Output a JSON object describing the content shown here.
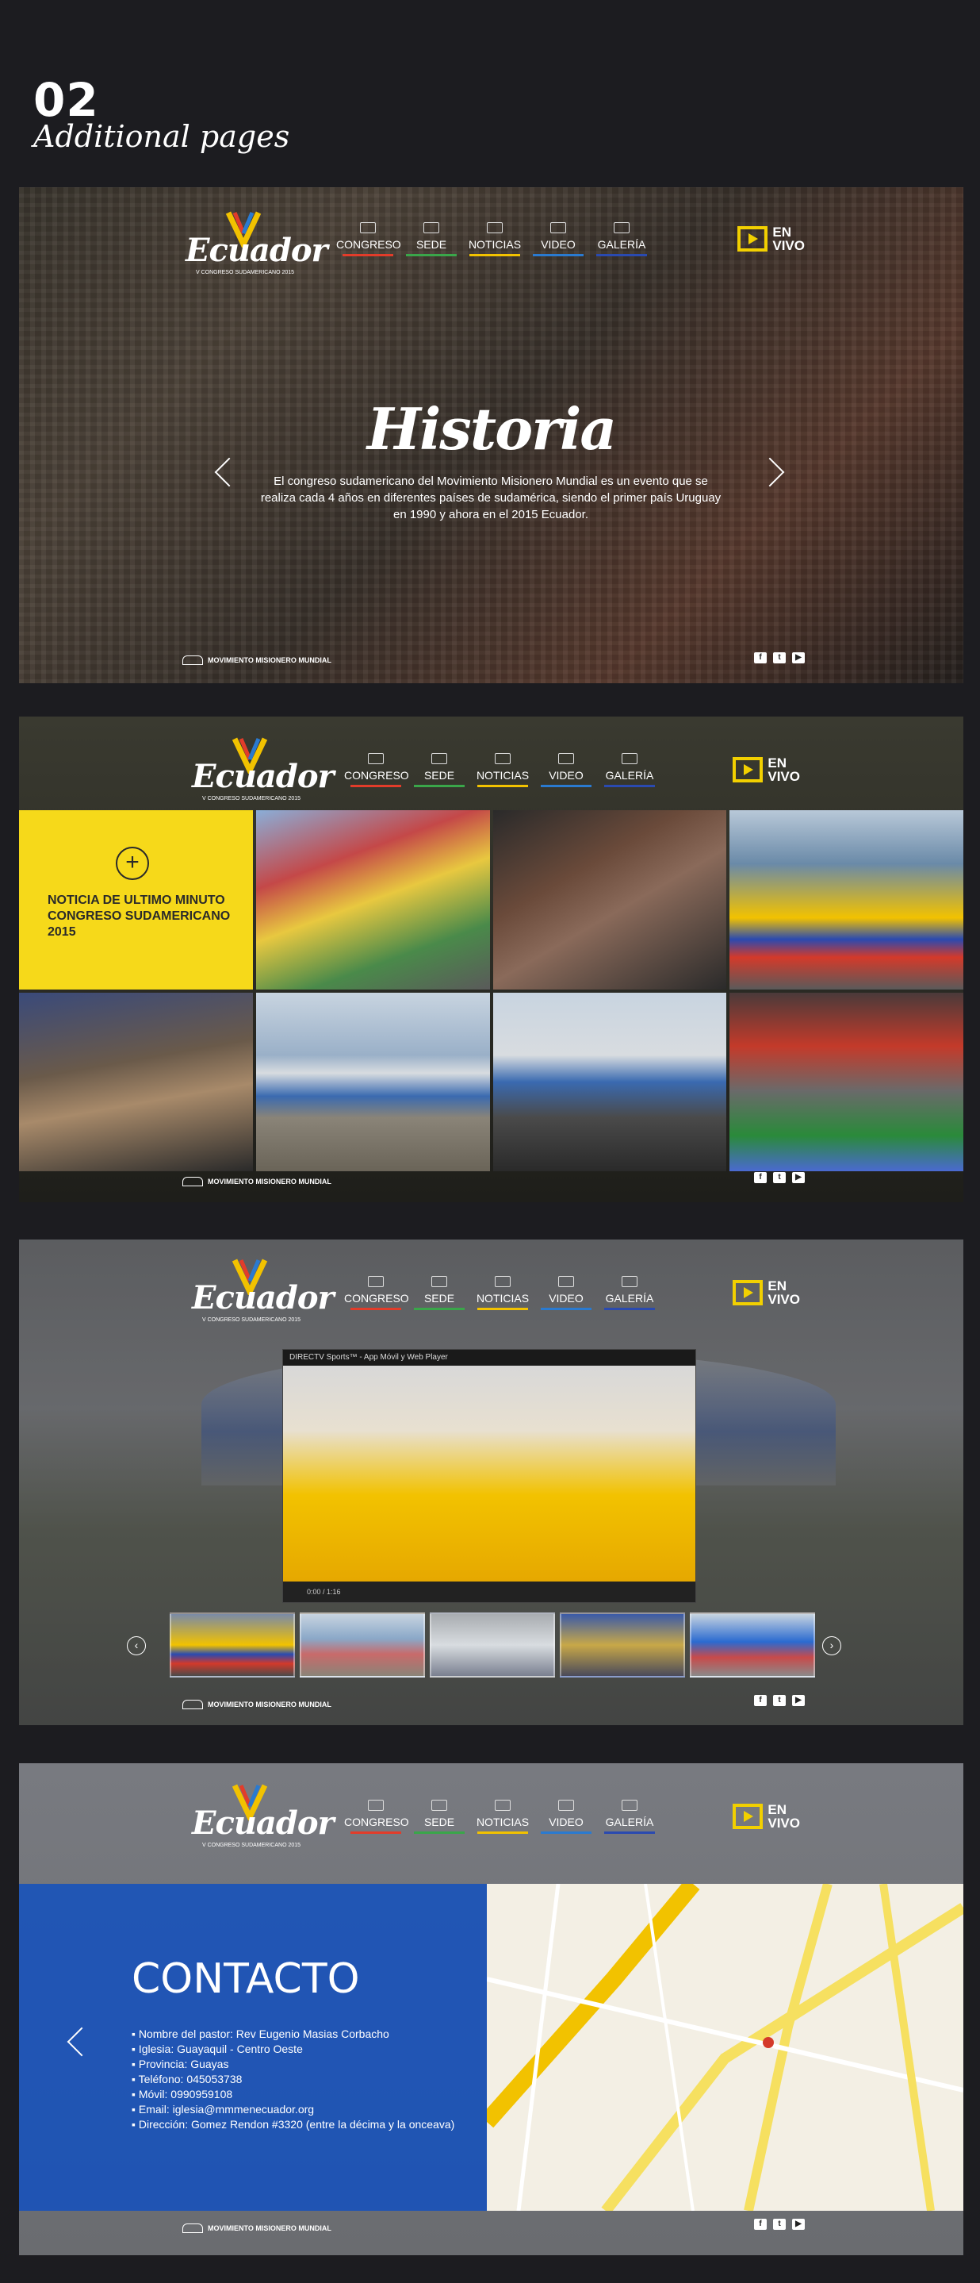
{
  "header": {
    "number": "02",
    "subtitle": "Additional pages"
  },
  "nav": {
    "items": [
      {
        "label": "CONGRESO",
        "color": "#e23c2a"
      },
      {
        "label": "SEDE",
        "color": "#3aa64a"
      },
      {
        "label": "NOTICIAS",
        "color": "#f2c200"
      },
      {
        "label": "VIDEO",
        "color": "#2a7ad0"
      },
      {
        "label": "GALERÍA",
        "color": "#2a4ab0"
      }
    ]
  },
  "logo": {
    "word": "Ecuador",
    "tag": "V CONGRESO SUDAMERICANO 2015"
  },
  "live": {
    "line1": "EN",
    "line2": "VIVO"
  },
  "footer": {
    "brand": "MOVIMIENTO MISIONERO MUNDIAL"
  },
  "historia": {
    "title": "Historia",
    "body": "El congreso sudamericano del Movimiento Misionero Mundial es un evento que se realiza cada 4 años en diferentes países de sudamérica, siendo el primer país Uruguay en 1990 y ahora en el 2015 Ecuador."
  },
  "news": {
    "title": "NOTICIA DE ULTIMO MINUTO CONGRESO SUDAMERICANO 2015"
  },
  "video": {
    "title": "DIRECTV Sports™ - App Móvil y Web Player",
    "time": "0:00 / 1:16"
  },
  "contacto": {
    "title": "CONTACTO",
    "items": [
      "Nombre del pastor: Rev Eugenio Masias Corbacho",
      "Iglesia: Guayaquil - Centro Oeste",
      "Provincia: Guayas",
      "Teléfono: 045053738",
      "Móvil: 0990959108",
      "Email: iglesia@mmmenecuador.org",
      "Dirección: Gomez Rendon #3320 (entre la décima y la onceava)"
    ]
  },
  "colors": {
    "accent_yellow": "#f6d91a",
    "contact_blue": "#1450be"
  }
}
